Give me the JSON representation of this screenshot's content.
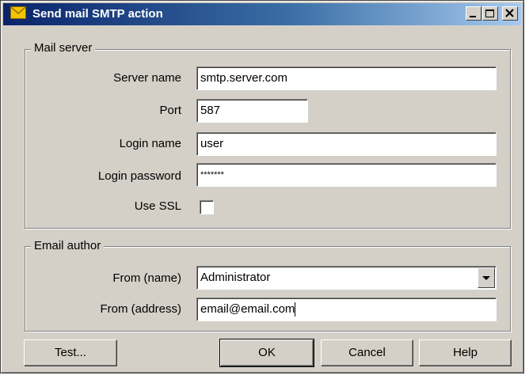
{
  "window": {
    "title": "Send mail SMTP action",
    "icon": "envelope-icon",
    "controls": [
      "minimize-icon",
      "maximize-icon",
      "close-icon"
    ]
  },
  "mail_server": {
    "legend": "Mail server",
    "server_name_label": "Server name",
    "server_name_value": "smtp.server.com",
    "port_label": "Port",
    "port_value": "587",
    "login_name_label": "Login name",
    "login_name_value": "user",
    "login_password_label": "Login password",
    "login_password_value": "*******",
    "use_ssl_label": "Use SSL",
    "use_ssl_checked": false
  },
  "email_author": {
    "legend": "Email author",
    "from_name_label": "From (name)",
    "from_name_value": "Administrator",
    "from_address_label": "From (address)",
    "from_address_value": "email@email.com"
  },
  "buttons": {
    "test": "Test...",
    "ok": "OK",
    "cancel": "Cancel",
    "help": "Help"
  },
  "colors": {
    "title_bar_start": "#0a246a",
    "title_bar_end": "#a6caf0",
    "dialog_face": "#d4d0c8",
    "envelope": "#f5c400"
  }
}
